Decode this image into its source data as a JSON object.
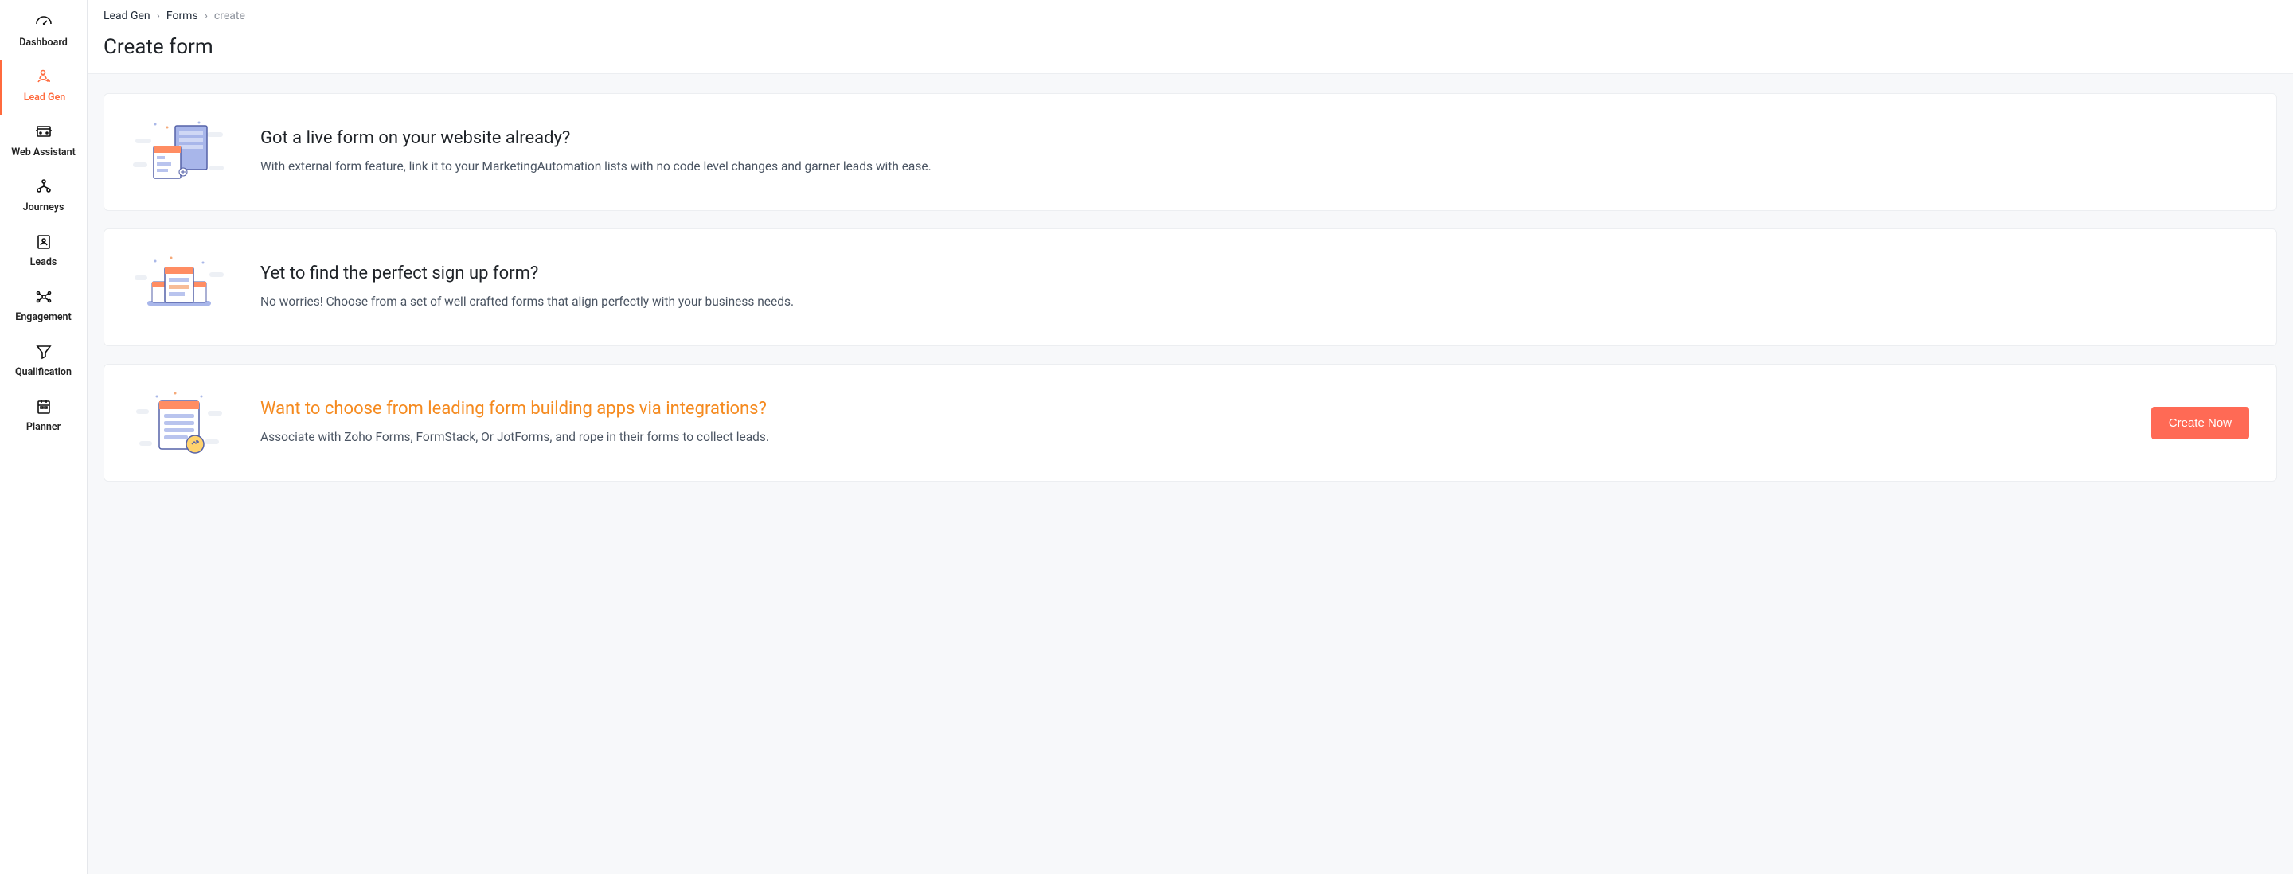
{
  "sidebar": {
    "items": [
      {
        "label": "Dashboard"
      },
      {
        "label": "Lead Gen"
      },
      {
        "label": "Web Assistant"
      },
      {
        "label": "Journeys"
      },
      {
        "label": "Leads"
      },
      {
        "label": "Engagement"
      },
      {
        "label": "Qualification"
      },
      {
        "label": "Planner"
      }
    ]
  },
  "breadcrumb": {
    "items": [
      {
        "label": "Lead Gen"
      },
      {
        "label": "Forms"
      },
      {
        "label": "create"
      }
    ]
  },
  "page": {
    "title": "Create form"
  },
  "cards": [
    {
      "title": "Got a live form on your website already?",
      "desc": "With external form feature, link it to your MarketingAutomation lists with no code level changes and garner leads with ease."
    },
    {
      "title": "Yet to find the perfect sign up form?",
      "desc": "No worries! Choose from a set of well crafted forms that align perfectly with your business needs."
    },
    {
      "title": "Want to choose from leading form building apps via integrations?",
      "desc": "Associate with Zoho Forms, FormStack, Or JotForms, and rope in their forms to collect leads.",
      "cta": "Create Now"
    }
  ]
}
